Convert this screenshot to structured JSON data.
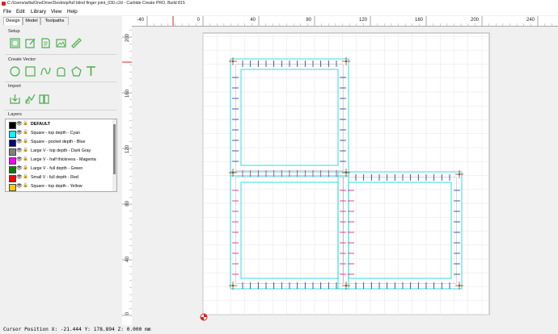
{
  "window": {
    "title": "C:/Users/willa/OneDrive/Desktop/full blind finger joint_030.c2d - Carbide Create PRO, Build 815"
  },
  "menu": [
    "File",
    "Edit",
    "Library",
    "View",
    "Help"
  ],
  "tabs": [
    "Design",
    "Model",
    "Toolpaths"
  ],
  "sections": {
    "setup": "Setup",
    "create_vector": "Create Vector",
    "import": "Import",
    "layers": "Layers"
  },
  "layers": [
    {
      "name": "DEFAULT",
      "color": "#000000",
      "bold": true
    },
    {
      "name": "Square - top depth - Cyan",
      "color": "#00ffff"
    },
    {
      "name": "Square - pocket depth - Blue",
      "color": "#000080"
    },
    {
      "name": "Large V - top depth - Dark Gray",
      "color": "#808080"
    },
    {
      "name": "Large V - half thickness - Magenta",
      "color": "#ff00ff"
    },
    {
      "name": "Large V - full depth - Green",
      "color": "#008000"
    },
    {
      "name": "Small V - full depth - Red",
      "color": "#ff0000"
    },
    {
      "name": "Square - top depth - Yellow",
      "color": "#ffcc00"
    }
  ],
  "ruler": {
    "x_labels": [
      "-40",
      "0",
      "40",
      "80",
      "120",
      "160",
      "200",
      "240"
    ],
    "y_labels": [
      "200",
      "160",
      "120",
      "80",
      "40",
      "0"
    ]
  },
  "status": {
    "cursor": "Cursor Position X: -21.444 Y: 178.894 Z: 0.000 mm"
  },
  "colors": {
    "accent": "#46b04a",
    "cyan": "#00d8d8",
    "blue": "#1a2f9a",
    "magenta": "#e0108a",
    "red": "#e02020",
    "green": "#1a8a1a"
  }
}
